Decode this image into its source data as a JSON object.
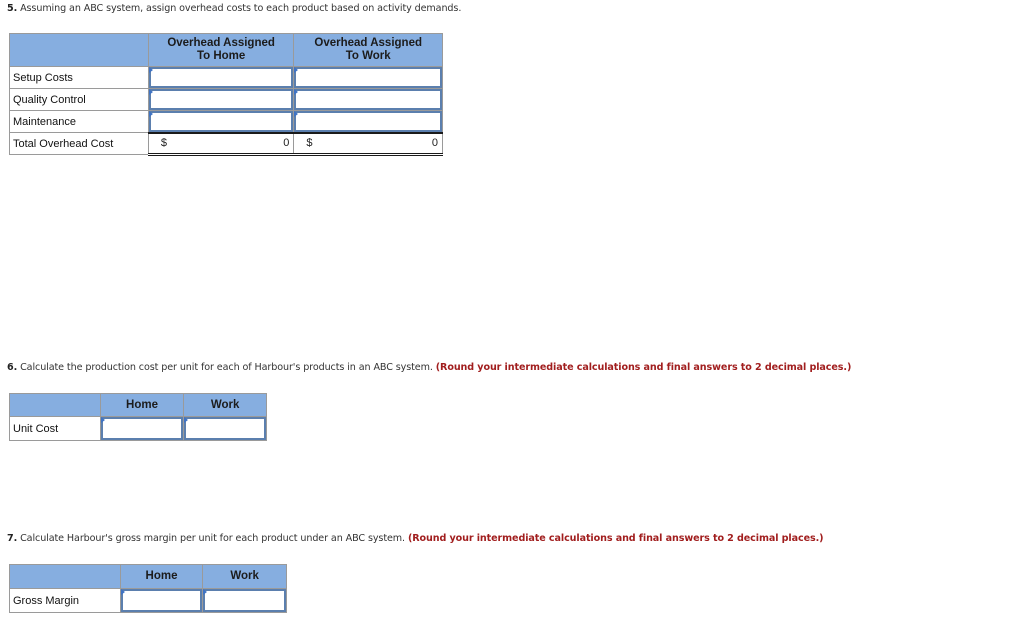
{
  "q5": {
    "number": "5.",
    "text": " Assuming an ABC system, assign overhead costs to each product based on activity demands.",
    "table": {
      "headers": [
        "",
        "Overhead Assigned To Home",
        "Overhead Assigned To Work"
      ],
      "header_lines": {
        "home": [
          "Overhead Assigned",
          "To Home"
        ],
        "work": [
          "Overhead Assigned",
          "To Work"
        ]
      },
      "rows": [
        {
          "label": "Setup Costs",
          "home": "",
          "work": ""
        },
        {
          "label": "Quality Control",
          "home": "",
          "work": ""
        },
        {
          "label": "Maintenance",
          "home": "",
          "work": ""
        }
      ],
      "total": {
        "label": "Total Overhead Cost",
        "home_currency": "$",
        "home_value": "0",
        "work_currency": "$",
        "work_value": "0"
      }
    }
  },
  "q6": {
    "number": "6.",
    "text": " Calculate the production cost per unit for each of Harbour's products in an ABC system. ",
    "hint": "(Round your intermediate calculations and final answers to 2 decimal places.)",
    "table": {
      "headers": [
        "",
        "Home",
        "Work"
      ],
      "rows": [
        {
          "label": "Unit Cost",
          "home": "",
          "work": ""
        }
      ]
    }
  },
  "q7": {
    "number": "7.",
    "text": " Calculate Harbour's gross margin per unit for each product under an ABC system. ",
    "hint": "(Round your intermediate calculations and final answers to 2 decimal places.)",
    "table": {
      "headers": [
        "",
        "Home",
        "Work"
      ],
      "rows": [
        {
          "label": "Gross Margin",
          "home": "",
          "work": ""
        }
      ]
    }
  },
  "colors": {
    "header_bg": "#86aee0",
    "input_border": "#5b7fae",
    "hint_red": "#a11e1e",
    "flag_blue": "#3f73c4"
  }
}
